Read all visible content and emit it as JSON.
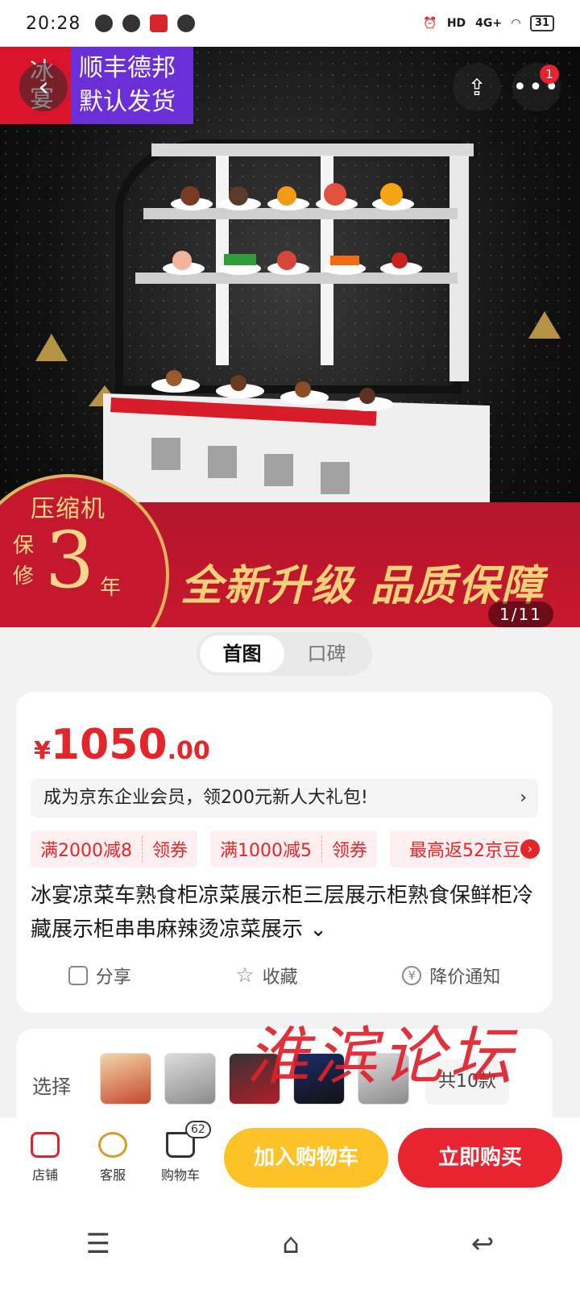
{
  "status_bar": {
    "time": "20:28",
    "network": "4G+",
    "battery": "31",
    "hd": "HD"
  },
  "hero": {
    "brand_text": "冰宴",
    "shipping_text": "顺丰德邦默认发货",
    "more_badge": "1",
    "warranty_title": "压缩机",
    "warranty_side": "保修",
    "warranty_number": "3",
    "warranty_unit": "年",
    "slogan": "全新升级 品质保障",
    "image_counter": "1/11"
  },
  "tabs": [
    {
      "label": "首图",
      "active": true
    },
    {
      "label": "口碑",
      "active": false
    }
  ],
  "price": {
    "currency": "¥",
    "integer": "1050",
    "decimal": ".00"
  },
  "member_bar": {
    "text": "成为京东企业会员，领200元新人大礼包!",
    "chevron": "›"
  },
  "coupons": [
    {
      "amount": "满2000减8",
      "action": "领券"
    },
    {
      "amount": "满1000减5",
      "action": "领券"
    },
    {
      "amount": "最高返52京豆"
    }
  ],
  "product_title": "冰宴凉菜车熟食柜凉菜展示柜三层展示柜熟食保鲜柜冷藏展示柜串串麻辣烫凉菜展示 ⌄",
  "actions": [
    {
      "label": "分享"
    },
    {
      "label": "收藏"
    },
    {
      "label": "降价通知"
    }
  ],
  "select": {
    "label": "选择",
    "count": "共10款"
  },
  "watermark": "淮滨论坛",
  "bottom_nav": {
    "shop": "店铺",
    "service": "客服",
    "cart": "购物车",
    "cart_count": "62",
    "add_to_cart": "加入购物车",
    "buy_now": "立即购买"
  },
  "colors": {
    "accent_red": "#e4262a",
    "add_yellow": "#fdc228",
    "buy_red": "#e82530",
    "purple": "#6a2fd6"
  }
}
